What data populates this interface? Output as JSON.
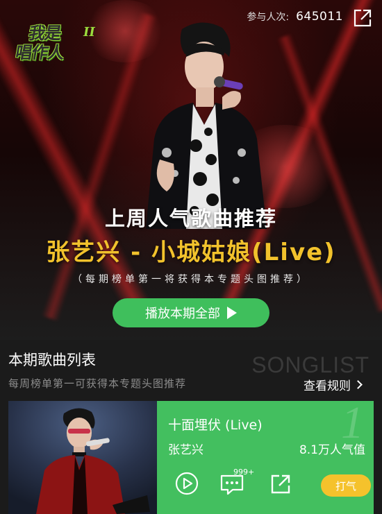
{
  "hero": {
    "logo_line1": "我是",
    "logo_line2": "唱作人",
    "logo_roman": "II",
    "participants_label": "参与人次:",
    "participants_count": "645011",
    "title": "上周人气歌曲推荐",
    "song": "张艺兴 - 小城姑娘(Live)",
    "note": "（每期榜单第一将获得本专题头图推荐）",
    "play_all_label": "播放本期全部"
  },
  "songlist": {
    "title": "本期歌曲列表",
    "watermark": "SONGLIST",
    "subtitle": "每周榜单第一可获得本专题头图推荐",
    "rules_label": "查看规则"
  },
  "card": {
    "rank": "1",
    "song_name": "十面埋伏 (Live)",
    "artist": "张艺兴",
    "popularity": "8.1万人气值",
    "comment_badge": "999+",
    "cheer_label": "打气"
  },
  "colors": {
    "accent_green": "#3fbf5c",
    "accent_yellow": "#f2c22c"
  },
  "icons": [
    "external-share-icon",
    "play-triangle-icon",
    "play-circle-icon",
    "comment-icon",
    "share-icon",
    "chevron-right-icon"
  ]
}
